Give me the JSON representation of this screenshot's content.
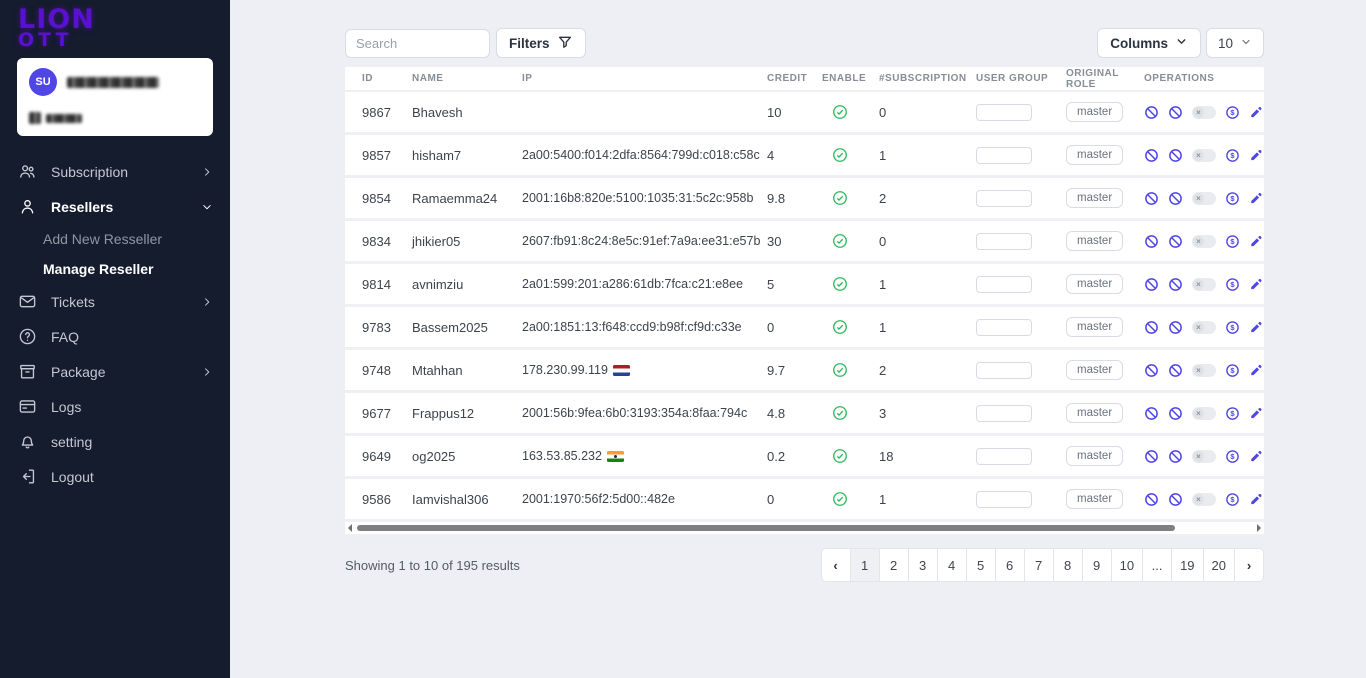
{
  "brand": {
    "line1": "LION",
    "line2": "OTT"
  },
  "user_card": {
    "initials": "SU"
  },
  "sidebar": {
    "items": [
      {
        "label": "Subscription",
        "icon": "users",
        "chevron": "right",
        "active": false
      },
      {
        "label": "Resellers",
        "icon": "person",
        "chevron": "down",
        "active": true,
        "children": [
          {
            "label": "Add New Resseller",
            "active": false
          },
          {
            "label": "Manage Reseller",
            "active": true
          }
        ]
      },
      {
        "label": "Tickets",
        "icon": "mail",
        "chevron": "right",
        "active": false
      },
      {
        "label": "FAQ",
        "icon": "help",
        "chevron": "",
        "active": false
      },
      {
        "label": "Package",
        "icon": "package",
        "chevron": "right",
        "active": false
      },
      {
        "label": "Logs",
        "icon": "logs",
        "chevron": "",
        "active": false
      },
      {
        "label": "setting",
        "icon": "bell",
        "chevron": "",
        "active": false
      },
      {
        "label": "Logout",
        "icon": "logout",
        "chevron": "",
        "active": false
      }
    ]
  },
  "toolbar": {
    "search_placeholder": "Search",
    "filters_label": "Filters",
    "columns_label": "Columns",
    "page_size": "10"
  },
  "table": {
    "columns": [
      "ID",
      "NAME",
      "IP",
      "CREDIT",
      "ENABLE",
      "#SUBSCRIPTION",
      "USER GROUP",
      "ORIGINAL ROLE",
      "OPERATIONS"
    ],
    "rows": [
      {
        "id": "9867",
        "name": "Bhavesh",
        "ip": "",
        "flag": "",
        "credit": "10",
        "enabled": true,
        "subscriptions": "0",
        "user_group": "",
        "original_role": "master"
      },
      {
        "id": "9857",
        "name": "hisham7",
        "ip": "2a00:5400:f014:2dfa:8564:799d:c018:c58c",
        "flag": "",
        "credit": "4",
        "enabled": true,
        "subscriptions": "1",
        "user_group": "",
        "original_role": "master"
      },
      {
        "id": "9854",
        "name": "Ramaemma24",
        "ip": "2001:16b8:820e:5100:1035:31:5c2c:958b",
        "flag": "",
        "credit": "9.8",
        "enabled": true,
        "subscriptions": "2",
        "user_group": "",
        "original_role": "master"
      },
      {
        "id": "9834",
        "name": "jhikier05",
        "ip": "2607:fb91:8c24:8e5c:91ef:7a9a:ee31:e57b",
        "flag": "",
        "credit": "30",
        "enabled": true,
        "subscriptions": "0",
        "user_group": "",
        "original_role": "master"
      },
      {
        "id": "9814",
        "name": "avnimziu",
        "ip": "2a01:599:201:a286:61db:7fca:c21:e8ee",
        "flag": "",
        "credit": "5",
        "enabled": true,
        "subscriptions": "1",
        "user_group": "",
        "original_role": "master"
      },
      {
        "id": "9783",
        "name": "Bassem2025",
        "ip": "2a00:1851:13:f648:ccd9:b98f:cf9d:c33e",
        "flag": "",
        "credit": "0",
        "enabled": true,
        "subscriptions": "1",
        "user_group": "",
        "original_role": "master"
      },
      {
        "id": "9748",
        "name": "Mtahhan",
        "ip": "178.230.99.119",
        "flag": "nl",
        "credit": "9.7",
        "enabled": true,
        "subscriptions": "2",
        "user_group": "",
        "original_role": "master"
      },
      {
        "id": "9677",
        "name": "Frappus12",
        "ip": "2001:56b:9fea:6b0:3193:354a:8faa:794c",
        "flag": "",
        "credit": "4.8",
        "enabled": true,
        "subscriptions": "3",
        "user_group": "",
        "original_role": "master"
      },
      {
        "id": "9649",
        "name": "og2025",
        "ip": "163.53.85.232",
        "flag": "in",
        "credit": "0.2",
        "enabled": true,
        "subscriptions": "18",
        "user_group": "",
        "original_role": "master"
      },
      {
        "id": "9586",
        "name": "Iamvishal306",
        "ip": "2001:1970:56f2:5d00::482e",
        "flag": "",
        "credit": "0",
        "enabled": true,
        "subscriptions": "1",
        "user_group": "",
        "original_role": "master"
      }
    ]
  },
  "footer": {
    "summary": "Showing 1 to 10 of 195 results",
    "prev_label": "‹",
    "next_label": "›",
    "pages": [
      "1",
      "2",
      "3",
      "4",
      "5",
      "6",
      "7",
      "8",
      "9",
      "10",
      "...",
      "19",
      "20"
    ],
    "active_page": "1"
  },
  "colors": {
    "accent_purple": "#4f46e5",
    "logo_purple": "#5a10d0",
    "success_green": "#2eb85c",
    "sidebar_bg": "#151c2d",
    "page_bg": "#edeff4"
  }
}
